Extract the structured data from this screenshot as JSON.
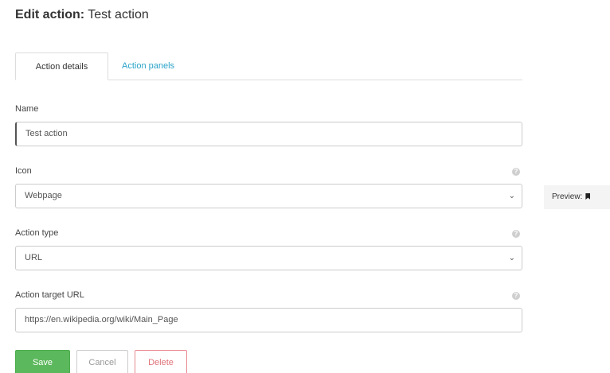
{
  "header": {
    "title_prefix": "Edit action:",
    "title_name": "Test action"
  },
  "tabs": [
    {
      "label": "Action details",
      "active": true
    },
    {
      "label": "Action panels",
      "active": false
    }
  ],
  "form": {
    "name": {
      "label": "Name",
      "value": "Test action"
    },
    "icon": {
      "label": "Icon",
      "value": "Webpage",
      "help": "?"
    },
    "action_type": {
      "label": "Action type",
      "value": "URL",
      "help": "?"
    },
    "target_url": {
      "label": "Action target URL",
      "value": "https://en.wikipedia.org/wiki/Main_Page",
      "help": "?"
    }
  },
  "preview": {
    "label": "Preview:",
    "icon": "bookmark-icon"
  },
  "buttons": {
    "save": "Save",
    "cancel": "Cancel",
    "delete": "Delete"
  },
  "colors": {
    "accent": "#2aa3c9",
    "save": "#5cb85c",
    "delete": "#e0737a"
  }
}
